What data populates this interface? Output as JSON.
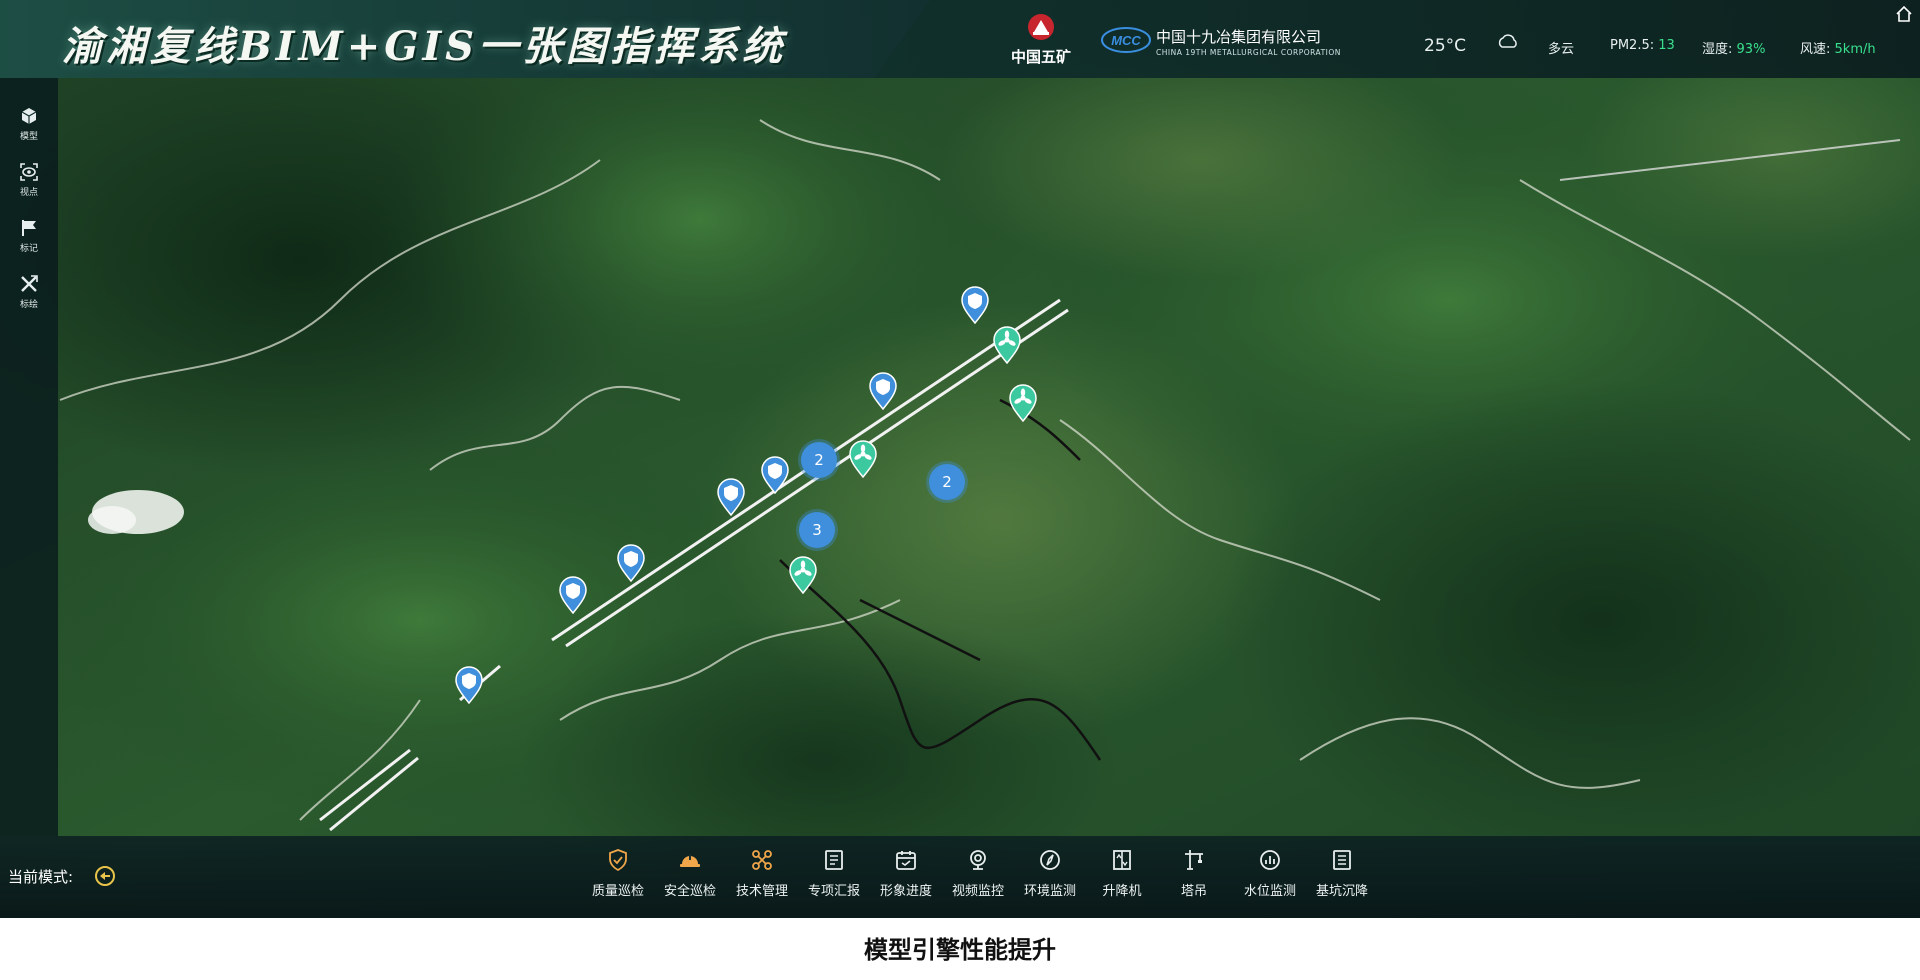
{
  "header": {
    "title": "渝湘复线BIM+GIS一张图指挥系统",
    "logo_left_name": "中国五矿",
    "logo_right_cn": "中国十九冶集团有限公司",
    "logo_right_en": "CHINA 19TH METALLURGICAL CORPORATION",
    "logo_right_mark": "MCC"
  },
  "weather": {
    "temperature": "25°C",
    "icon": "cloudy-icon",
    "description": "多云",
    "pm25_label": "PM2.5:",
    "pm25_value": "13",
    "humidity_label": "湿度:",
    "humidity_value": "93%",
    "wind_label": "风速:",
    "wind_value": "5km/h"
  },
  "left_toolbar": {
    "items": [
      {
        "label": "模型",
        "icon": "cube-icon"
      },
      {
        "label": "视点",
        "icon": "viewpoint-icon"
      },
      {
        "label": "标记",
        "icon": "flag-icon"
      },
      {
        "label": "标绘",
        "icon": "plot-icon"
      }
    ]
  },
  "bottom_bar": {
    "mode_label": "当前模式:",
    "mode_icon": "mode-icon",
    "items": [
      {
        "label": "质量巡检",
        "icon": "shield-check-icon",
        "color": "#f0a64a"
      },
      {
        "label": "安全巡检",
        "icon": "helmet-icon",
        "color": "#f0a64a"
      },
      {
        "label": "技术管理",
        "icon": "nodes-icon",
        "color": "#f0a64a"
      },
      {
        "label": "专项汇报",
        "icon": "report-icon",
        "color": "#e8eeee"
      },
      {
        "label": "形象进度",
        "icon": "calendar-icon",
        "color": "#e8eeee"
      },
      {
        "label": "视频监控",
        "icon": "camera-icon",
        "color": "#e8eeee"
      },
      {
        "label": "环境监测",
        "icon": "compass-icon",
        "color": "#e8eeee"
      },
      {
        "label": "升降机",
        "icon": "elevator-icon",
        "color": "#e8eeee"
      },
      {
        "label": "塔吊",
        "icon": "crane-icon",
        "color": "#e8eeee"
      },
      {
        "label": "水位监测",
        "icon": "water-level-icon",
        "color": "#e8eeee"
      },
      {
        "label": "基坑沉降",
        "icon": "settlement-icon",
        "color": "#e8eeee"
      }
    ]
  },
  "map": {
    "clusters": [
      "2",
      "2",
      "3"
    ],
    "pin_types": [
      "shield-pin-icon",
      "fan-pin-icon"
    ]
  },
  "caption": "模型引擎性能提升",
  "colors": {
    "accent_green": "#39e08e",
    "accent_orange": "#f0a64a",
    "pin_blue": "#3f8fdc",
    "pin_teal": "#3cc9a0"
  }
}
